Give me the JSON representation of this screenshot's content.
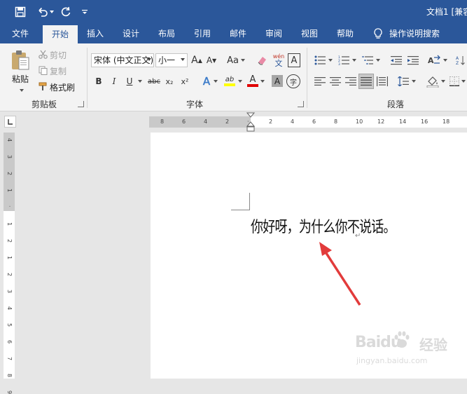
{
  "title_bar": {
    "doc_title": "文档1 [兼容"
  },
  "tabs": [
    {
      "label": "文件"
    },
    {
      "label": "开始"
    },
    {
      "label": "插入"
    },
    {
      "label": "设计"
    },
    {
      "label": "布局"
    },
    {
      "label": "引用"
    },
    {
      "label": "邮件"
    },
    {
      "label": "审阅"
    },
    {
      "label": "视图"
    },
    {
      "label": "帮助"
    }
  ],
  "tell_me": "操作说明搜索",
  "clipboard": {
    "paste": "粘贴",
    "cut": "剪切",
    "copy": "复制",
    "format_painter": "格式刷",
    "group": "剪贴板"
  },
  "font": {
    "name": "宋体 (中文正文)",
    "size": "小一",
    "group": "字体",
    "grow": "A",
    "shrink": "A",
    "case": "Aa",
    "pinyin_top": "wén",
    "pinyin_bottom": "文",
    "border_char": "A",
    "bold": "B",
    "italic": "I",
    "underline": "U",
    "strike": "abc",
    "sub": "x₂",
    "sup": "x²",
    "effects": "A",
    "highlight": "ab",
    "color": "A",
    "shade": "A",
    "enclose": "字"
  },
  "paragraph": {
    "group": "段落"
  },
  "document": {
    "text": "你好呀，为什么你不说话。",
    "para_mark": "↵"
  },
  "ruler": {
    "h_ticks": [
      "8",
      "6",
      "4",
      "2",
      "",
      "2",
      "4",
      "6",
      "8",
      "10",
      "12",
      "14",
      "16",
      "18"
    ],
    "v_ticks": [
      "4",
      "3",
      "2",
      "1",
      "",
      "1",
      "2",
      "1",
      "2",
      "3",
      "4",
      "5",
      "6",
      "7",
      "8",
      "9"
    ]
  },
  "watermark": {
    "brand": "Baidu",
    "sub": "经验",
    "url": "jingyan.baidu.com"
  },
  "colors": {
    "ribbon_blue": "#2b579a",
    "arrow_red": "#e23b3b",
    "highlight_yellow": "#ffff00",
    "font_red": "#e00000"
  }
}
